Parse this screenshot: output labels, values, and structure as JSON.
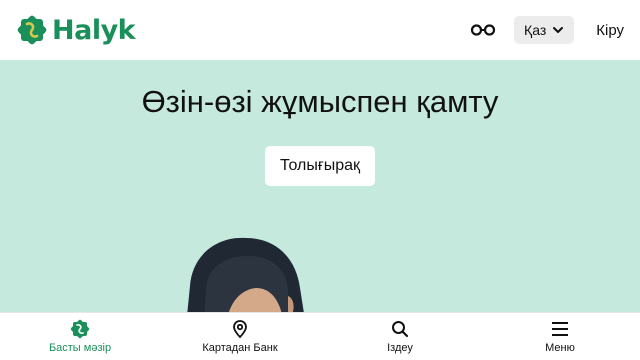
{
  "header": {
    "logo_text": "Halyk",
    "accessibility_icon": "glasses-icon",
    "language": "Қаз",
    "login": "Кіру"
  },
  "hero": {
    "title": "Өзін-өзі жұмыспен қамту",
    "more_button": "Толығырақ"
  },
  "bottom_nav": [
    {
      "label": "Басты мәзір",
      "icon": "halyk-logo-icon",
      "active": true
    },
    {
      "label": "Картадан Банк",
      "icon": "location-pin-icon",
      "active": false
    },
    {
      "label": "Іздеу",
      "icon": "search-icon",
      "active": false
    },
    {
      "label": "Меню",
      "icon": "hamburger-menu-icon",
      "active": false
    }
  ],
  "colors": {
    "brand_green": "#1a8f5a",
    "hero_bg": "#c5e9dc"
  }
}
